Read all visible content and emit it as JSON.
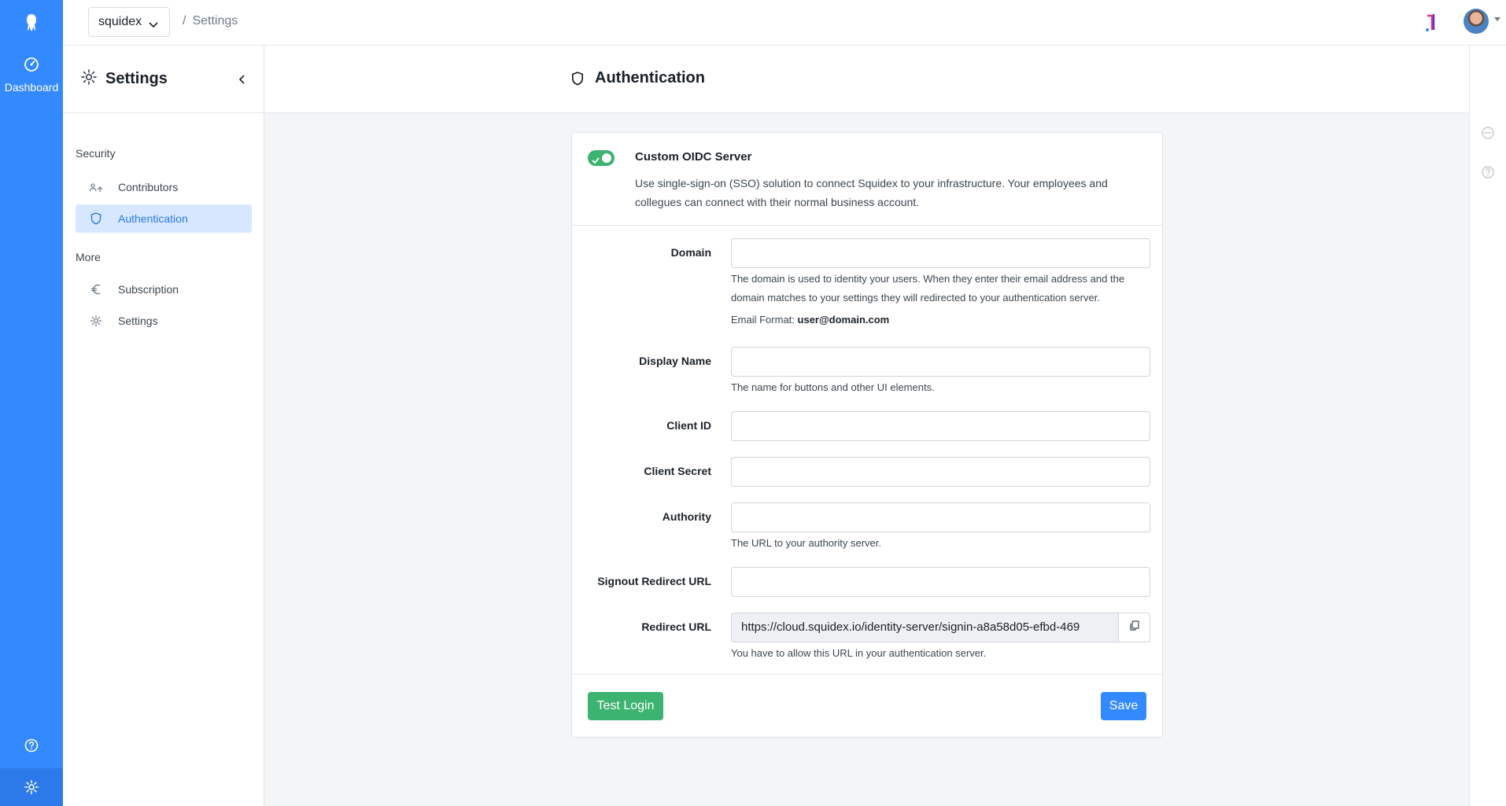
{
  "colors": {
    "accent": "#3389ff",
    "success": "#3cb371",
    "active_bg": "#d6e7ff"
  },
  "leftnav": {
    "logo_icon": "squidex-logo-icon",
    "dashboard_label": "Dashboard",
    "dashboard_icon": "gauge-icon",
    "help_icon": "help-circle-icon",
    "settings_icon": "gear-icon"
  },
  "topbar": {
    "app_name": "squidex",
    "breadcrumb_sep": "/",
    "breadcrumb": "Settings"
  },
  "settings_panel": {
    "title": "Settings",
    "groups": [
      {
        "label": "Security"
      },
      {
        "label": "More"
      }
    ],
    "items": [
      {
        "label": "Contributors",
        "icon": "contributors-icon"
      },
      {
        "label": "Authentication",
        "icon": "shield-icon",
        "active": true
      },
      {
        "label": "Subscription",
        "icon": "euro-icon"
      },
      {
        "label": "Settings",
        "icon": "gear-icon"
      }
    ]
  },
  "main": {
    "title": "Authentication",
    "card": {
      "heading": "Custom OIDC Server",
      "toggle_on": true,
      "description": "Use single-sign-on (SSO) solution to connect Squidex to your infrastructure. Your employees and collegues can connect with their normal business account.",
      "fields": {
        "domain": {
          "label": "Domain",
          "value": "",
          "hint": "The domain is used to identity your users. When they enter their email address and the domain matches to your settings they will redirected to your authentication server.",
          "format_label": "Email Format:",
          "format_value": "user@domain.com"
        },
        "display_name": {
          "label": "Display Name",
          "value": "",
          "hint": "The name for buttons and other UI elements."
        },
        "client_id": {
          "label": "Client ID",
          "value": ""
        },
        "client_secret": {
          "label": "Client Secret",
          "value": ""
        },
        "authority": {
          "label": "Authority",
          "value": "",
          "hint": "The URL to your authority server."
        },
        "signout_redirect": {
          "label": "Signout Redirect URL",
          "value": ""
        },
        "redirect": {
          "label": "Redirect URL",
          "value": "https://cloud.squidex.io/identity-server/signin-a8a58d05-efbd-469",
          "hint": "You have to allow this URL in your authentication server."
        }
      },
      "test_login_label": "Test Login",
      "save_label": "Save"
    }
  }
}
